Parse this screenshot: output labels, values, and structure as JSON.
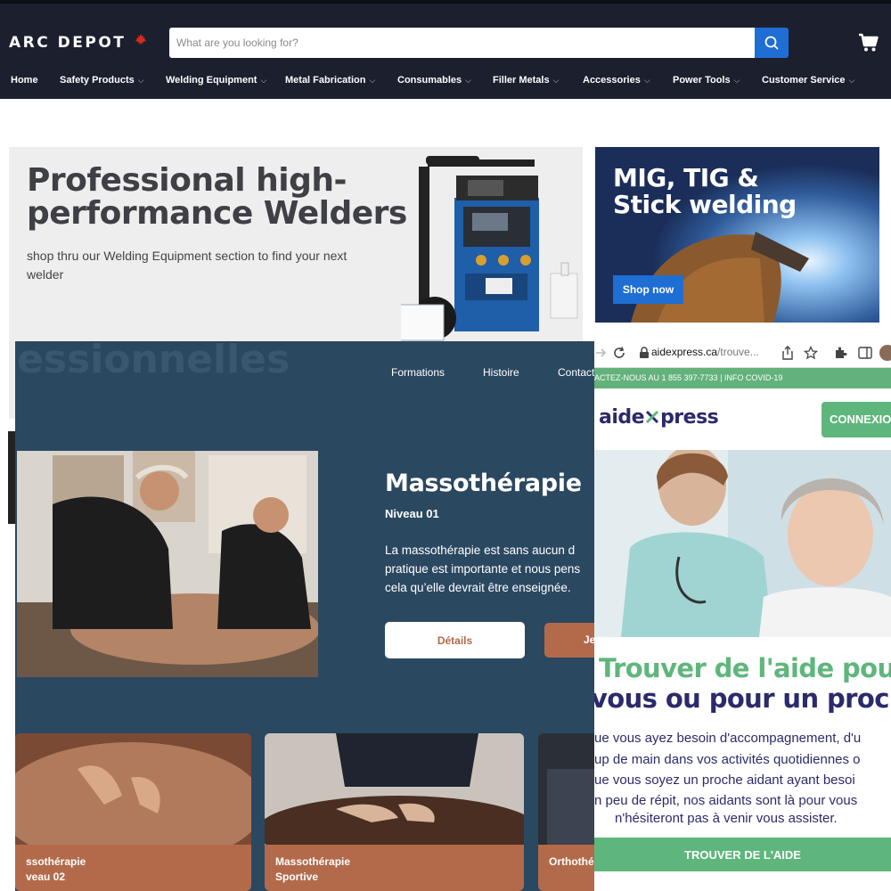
{
  "arcdepot": {
    "logo": "ARC DEPOT",
    "search": {
      "placeholder": "What are you looking for?"
    },
    "nav": [
      "Home",
      "Safety Products",
      "Welding Equipment",
      "Metal Fabrication",
      "Consumables",
      "Filler Metals",
      "Accessories",
      "Power Tools",
      "Customer Service"
    ],
    "hero": {
      "title": "Professional high-performance Welders",
      "subtitle": "shop thru our Welding Equipment section to find your next welder"
    },
    "promo": {
      "title_line1": "MIG, TIG &",
      "title_line2": "Stick welding",
      "button": "Shop now"
    },
    "colors": {
      "header_bg": "#1c1f2e",
      "accent": "#1e6ed4",
      "maple": "#d52b1e"
    }
  },
  "massotherapie": {
    "ghost_text": "essionnelles",
    "nav": [
      "Formations",
      "Histoire",
      "Contact"
    ],
    "title": "Massothérapie",
    "level": "Niveau 01",
    "description_lines": [
      "La massothérapie est sans aucun d",
      "pratique est importante et nous pens",
      "cela qu’elle devrait être enseignée."
    ],
    "details_button": "Détails",
    "secondary_button": "Je",
    "cards": [
      {
        "line1": "ssothérapie",
        "line2": "veau 02"
      },
      {
        "line1": "Massothérapie",
        "line2": "Sportive"
      },
      {
        "line1": "Orthothé",
        "line2": ""
      }
    ],
    "colors": {
      "bg": "#2b4861",
      "accent": "#b36a4a"
    }
  },
  "aidexpress": {
    "url_domain": "aidexpress.ca",
    "url_path": "/trouve...",
    "top_bar": "ACTEZ-NOUS AU 1 855 397-7733  |  INFO COVID-19",
    "logo_left": "aide",
    "logo_right": "press",
    "connexion": "CONNEXIO",
    "heading_line1": "Trouver de l'aide pour",
    "heading_line2": "vous ou pour un proche",
    "body_lines": [
      "ue vous ayez besoin d'accompagnement, d'u",
      "up de main dans vos activités quotidiennes o",
      "ue vous soyez un proche aidant ayant besoi",
      "n peu de répit, nos aidants sont là pour vous",
      "n'hésiteront pas à venir vous assister."
    ],
    "cta": "TROUVER DE L'AIDE",
    "colors": {
      "green": "#5fb67c",
      "navy": "#2b2a6b"
    }
  }
}
